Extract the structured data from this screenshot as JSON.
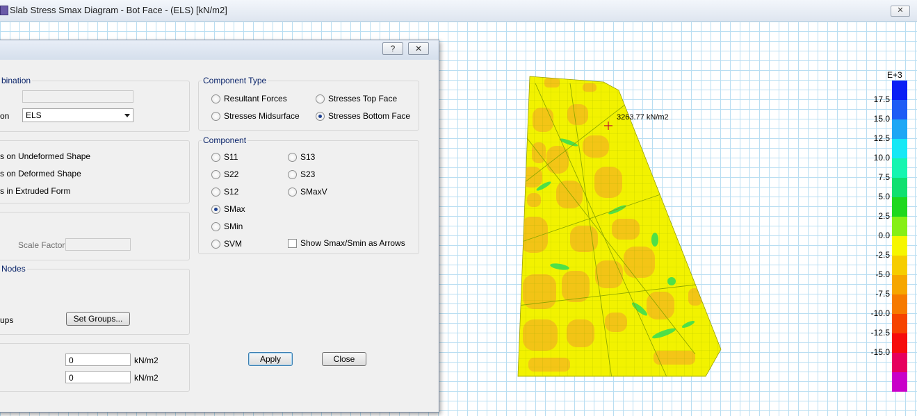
{
  "window": {
    "title": "Slab Stress Smax Diagram - Bot Face - (ELS)  [kN/m2]",
    "close_label": "✕"
  },
  "dialog": {
    "help_label": "?",
    "close_label": "✕",
    "combination_group": {
      "label": "bination",
      "row1_value": "",
      "row2_label": "on",
      "row2_value": "ELS"
    },
    "shape_group": {
      "options": [
        "s on Undeformed Shape",
        "s on Deformed Shape",
        "s in Extruded Form"
      ]
    },
    "scale_group": {
      "scale_factor_label": "Scale Factor",
      "scale_factor_value": ""
    },
    "nodes_group": {
      "label": "Nodes",
      "groups_label": "ups",
      "set_groups_button": "Set Groups..."
    },
    "range_group": {
      "min_value": "0",
      "max_value": "0",
      "unit": "kN/m2"
    },
    "component_type": {
      "label": "Component Type",
      "options": [
        {
          "label": "Resultant Forces",
          "selected": false
        },
        {
          "label": "Stresses Top Face",
          "selected": false
        },
        {
          "label": "Stresses Midsurface",
          "selected": false
        },
        {
          "label": "Stresses Bottom Face",
          "selected": true
        }
      ]
    },
    "component": {
      "label": "Component",
      "options_left": [
        {
          "label": "S11",
          "selected": false
        },
        {
          "label": "S22",
          "selected": false
        },
        {
          "label": "S12",
          "selected": false
        },
        {
          "label": "SMax",
          "selected": true
        },
        {
          "label": "SMin",
          "selected": false
        },
        {
          "label": "SVM",
          "selected": false
        }
      ],
      "options_right": [
        {
          "label": "S13",
          "selected": false
        },
        {
          "label": "S23",
          "selected": false
        },
        {
          "label": "SMaxV",
          "selected": false
        }
      ],
      "show_arrows_label": "Show Smax/Smin as Arrows",
      "show_arrows_checked": false
    },
    "apply_label": "Apply",
    "close_button_label": "Close"
  },
  "diagram": {
    "annotation": "3263.77 kN/m2",
    "colors": {
      "slab_fill": "#f2f200",
      "hotspot_fill": "#f3c218",
      "concentration_fill": "#33dd55",
      "mesh_line": "#8fa800"
    }
  },
  "legend": {
    "exponent": "E+3",
    "ticks": [
      "17.5",
      "15.0",
      "12.5",
      "10.0",
      "7.5",
      "5.0",
      "2.5",
      "0.0",
      "-2.5",
      "-5.0",
      "-7.5",
      "-10.0",
      "-12.5",
      "-15.0"
    ],
    "colors": [
      "#0b1ff5",
      "#1e5cf5",
      "#1ea7f5",
      "#16e8f5",
      "#16f5b0",
      "#10e070",
      "#1ed81e",
      "#86ef16",
      "#f6f600",
      "#f6cd00",
      "#f6a600",
      "#f67a00",
      "#f64300",
      "#f60c0c",
      "#e6005e",
      "#c900c9"
    ]
  }
}
